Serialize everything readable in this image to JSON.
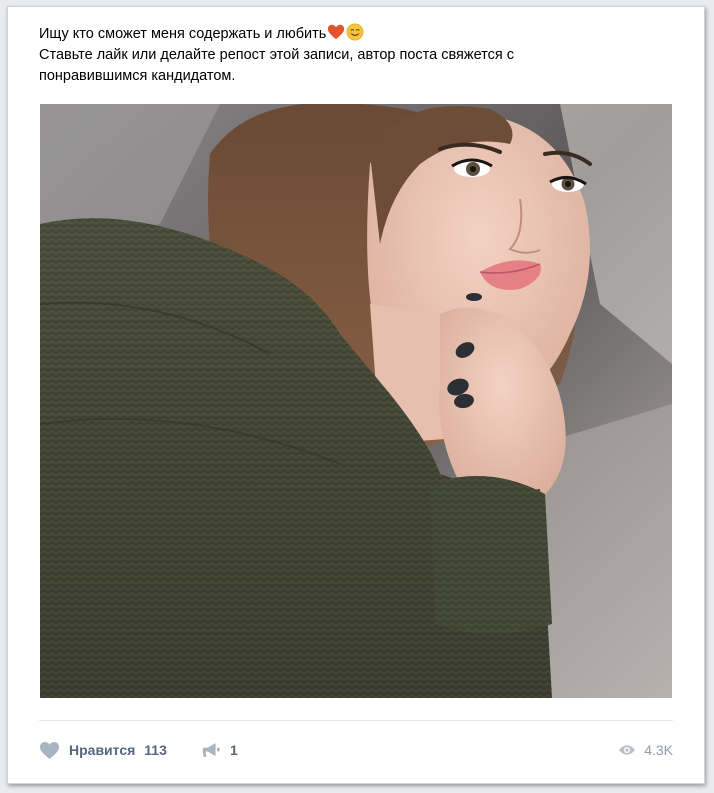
{
  "post": {
    "text_line1": "Ищу кто сможет меня содержать и любить",
    "text_line2": "Ставьте лайк или делайте репост этой записи, автор поста свяжется с",
    "text_line3": "понравившимся кандидатом.",
    "emojis": [
      "heart-emoji",
      "smiling-face-emoji"
    ]
  },
  "actions": {
    "like_label": "Нравится",
    "like_count": "113",
    "share_count": "1",
    "views_count": "4.3K"
  },
  "colors": {
    "action_text": "#55677d",
    "views_text": "#939ba6",
    "heart_emoji": "#e0552b",
    "smile_emoji": "#f7c63a"
  }
}
